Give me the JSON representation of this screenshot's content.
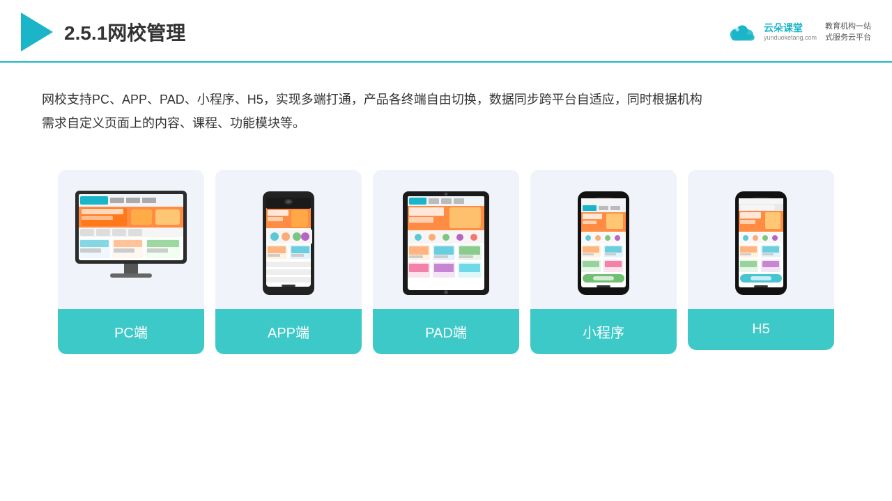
{
  "header": {
    "title": "2.5.1网校管理",
    "brand_name": "云朵课堂",
    "brand_url": "yunduoketang.com",
    "brand_slogan": "教育机构一站\n式服务云平台"
  },
  "description": "网校支持PC、APP、PAD、小程序、H5，实现多端打通，产品各终端自由切换，数据同步跨平台自适应，同时根据机构\n需求自定义页面上的内容、课程、功能模块等。",
  "cards": [
    {
      "id": "pc",
      "label": "PC端"
    },
    {
      "id": "app",
      "label": "APP端"
    },
    {
      "id": "pad",
      "label": "PAD端"
    },
    {
      "id": "miniprogram",
      "label": "小程序"
    },
    {
      "id": "h5",
      "label": "H5"
    }
  ],
  "colors": {
    "accent": "#3ec9c9",
    "text_dark": "#333333",
    "card_bg": "#eef2f8"
  }
}
